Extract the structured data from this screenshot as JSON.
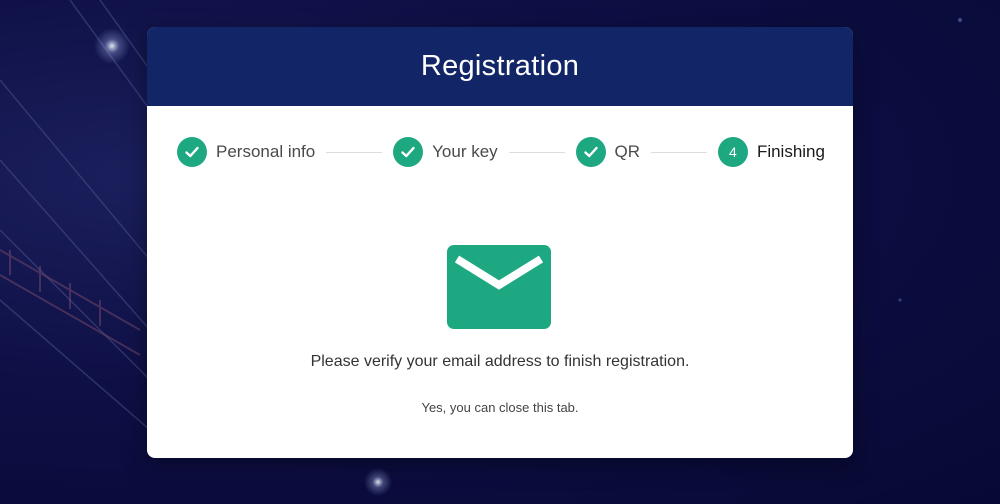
{
  "header": {
    "title": "Registration"
  },
  "stepper": {
    "steps": [
      {
        "label": "Personal info",
        "state": "completed",
        "icon": "check-icon"
      },
      {
        "label": "Your key",
        "state": "completed",
        "icon": "check-icon"
      },
      {
        "label": "QR",
        "state": "completed",
        "icon": "check-icon"
      },
      {
        "label": "Finishing",
        "state": "active",
        "number": "4"
      }
    ]
  },
  "content": {
    "icon": "envelope-icon",
    "message": "Please verify your email address to finish registration.",
    "note": "Yes, you can close this tab."
  },
  "colors": {
    "header_bg": "#112567",
    "accent": "#1ea882",
    "page_bg": "#0e0f45"
  }
}
